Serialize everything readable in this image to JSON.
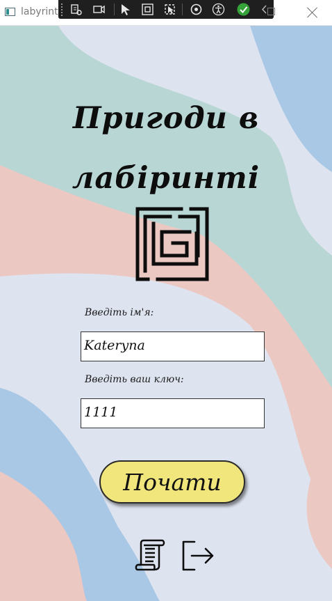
{
  "window": {
    "title": "labyrint"
  },
  "header": {
    "title_line1": "Пригоди в",
    "title_line2": "лабіринті"
  },
  "form": {
    "name_label": "Введіть ім'я:",
    "name_value": "Kateryna",
    "key_label": "Введіть ваш ключ:",
    "key_value": "1111"
  },
  "actions": {
    "start_label": "Почати"
  },
  "icons": {
    "app": "window-app-icon",
    "maze": "maze-icon",
    "rules": "scroll-icon",
    "exit": "exit-icon",
    "close": "close-icon"
  },
  "colors": {
    "bg_lavender": "#dde3ef",
    "bg_mint": "#b8d6d4",
    "bg_pink": "#ecc8c2",
    "bg_blue": "#a9c8e6",
    "button_yellow": "#f1e67c"
  }
}
